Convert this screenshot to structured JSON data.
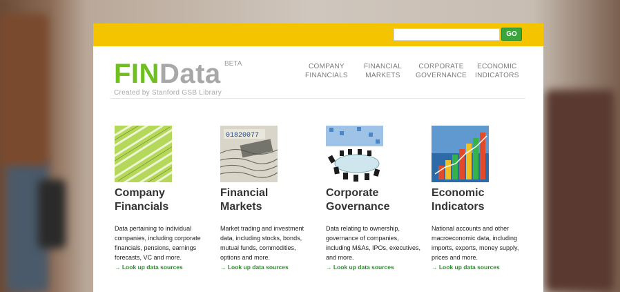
{
  "search": {
    "placeholder": "",
    "value": "",
    "go_label": "GO"
  },
  "logo": {
    "fin": "FIN",
    "data": "Data",
    "beta": "BETA",
    "tagline": "Created by Stanford GSB Library"
  },
  "nav": [
    {
      "label": "COMPANY\nFINANCIALS"
    },
    {
      "label": "FINANCIAL\nMARKETS"
    },
    {
      "label": "CORPORATE\nGOVERNANCE"
    },
    {
      "label": "ECONOMIC\nINDICATORS"
    }
  ],
  "categories": [
    {
      "title": "Company\nFinancials",
      "description": "Data pertaining to individual companies, including corporate financials, pensions, earnings forecasts, VC and more.",
      "link": "→ Look up data sources",
      "icon": "spreadsheet-image-icon"
    },
    {
      "title": "Financial\nMarkets",
      "description": "Market trading and investment data, including stocks, bonds, mutual funds, commodities, options and more.",
      "link": "→ Look up data sources",
      "icon": "dollar-bill-image-icon"
    },
    {
      "title": "Corporate\nGovernance",
      "description": "Data relating to ownership, governance of companies, including M&As, IPOs, executives, and more.",
      "link": "→ Look up data sources",
      "icon": "boardroom-table-image-icon"
    },
    {
      "title": "Economic\nIndicators",
      "description": "National accounts and other macroeconomic data, including imports, exports, money supply, prices and more.",
      "link": "→ Look up data sources",
      "icon": "bar-chart-image-icon"
    }
  ],
  "colors": {
    "topbar": "#f5c400",
    "logo_green": "#6fbf1f",
    "link_green": "#2b8a2b"
  }
}
